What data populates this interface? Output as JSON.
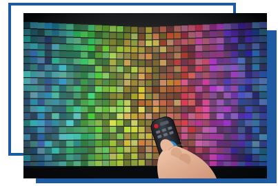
{
  "photo": {
    "subject": "hand-holding-remote-control-in-front-of-video-wall",
    "colors": {
      "frame": "#1d5aa2",
      "remote_body": "#2b2f36",
      "remote_ring": "#2a8fd6",
      "remote_red_button": "#d11f2c",
      "skin": "#e8b89a",
      "wall_background": "#07090c"
    }
  }
}
